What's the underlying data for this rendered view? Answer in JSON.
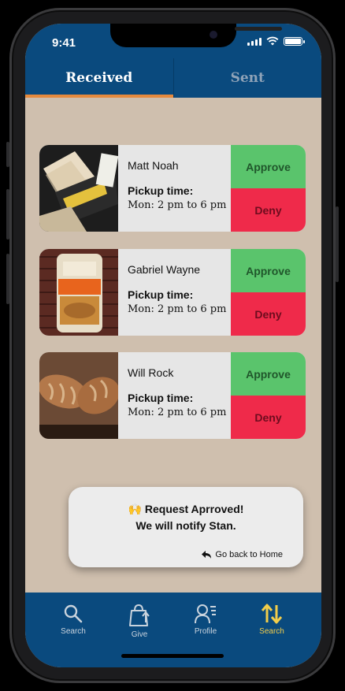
{
  "status_bar": {
    "time": "9:41"
  },
  "tabs": [
    {
      "label": "Received",
      "active": true
    },
    {
      "label": "Sent",
      "active": false
    }
  ],
  "requests": [
    {
      "name": "Matt Noah",
      "pickup_label": "Pickup time:",
      "pickup_time": "Mon: 2 pm to 6 pm",
      "image": "sliced-bread-sandwich-package",
      "approve_label": "Approve",
      "deny_label": "Deny"
    },
    {
      "name": "Gabriel Wayne",
      "pickup_label": "Pickup time:",
      "pickup_time": "Mon: 2 pm to 6 pm",
      "image": "packaged-bread-loaf",
      "approve_label": "Approve",
      "deny_label": "Deny"
    },
    {
      "name": "Will Rock",
      "pickup_label": "Pickup time:",
      "pickup_time": "Mon: 2 pm to 6 pm",
      "image": "artisan-bread-loaves",
      "approve_label": "Approve",
      "deny_label": "Deny"
    }
  ],
  "toast": {
    "emoji": "🙌",
    "title": "Request Aprroved!",
    "subtitle": "We will notify Stan.",
    "back_label": "Go back to Home"
  },
  "bottom_nav": [
    {
      "label": "Search",
      "icon": "search-icon",
      "active": false
    },
    {
      "label": "Give",
      "icon": "give-bag-icon",
      "active": false
    },
    {
      "label": "Profile",
      "icon": "profile-icon",
      "active": false
    },
    {
      "label": "Search",
      "icon": "sort-arrows-icon",
      "active": true
    }
  ],
  "colors": {
    "nav_blue": "#0a4a7e",
    "background_beige": "#cfbfae",
    "tab_accent": "#e58a3e",
    "approve_green": "#5ac46c",
    "deny_red": "#ef2a4a",
    "active_nav_yellow": "#f2cd4a"
  }
}
